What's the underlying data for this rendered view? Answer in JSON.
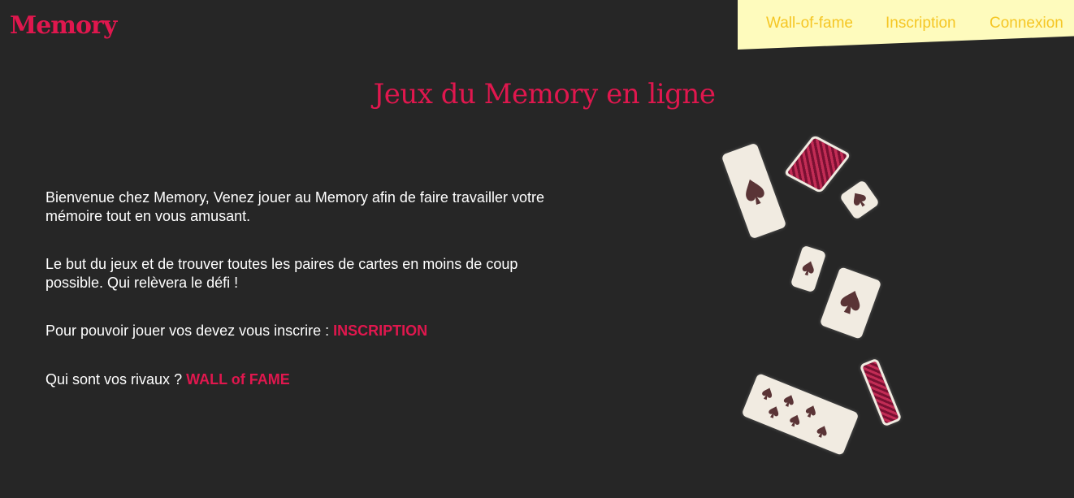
{
  "header": {
    "logo": "Memory",
    "nav": {
      "wall_of_fame": "Wall-of-fame",
      "inscription": "Inscription",
      "connexion": "Connexion"
    }
  },
  "main": {
    "title": "Jeux du Memory en ligne",
    "intro": "Bienvenue chez Memory, Venez jouer au Memory afin de faire travailler votre mémoire tout en vous amusant.",
    "goal": "Le but du jeux et de trouver toutes les paires de cartes en moins de coup possible. Qui relèvera le défi !",
    "signup_text": "Pour pouvoir jouer vos devez vous inscrire : ",
    "signup_link": "INSCRIPTION",
    "rivals_text": "Qui sont vos rivaux ? ",
    "rivals_link": "WALL of FAME"
  },
  "image": {
    "icon": "flying-playing-cards-illustration"
  },
  "colors": {
    "background": "#262626",
    "accent": "#e0174e",
    "nav_bg": "#fefbbd",
    "nav_text": "#f5c624",
    "text": "#ffffff"
  }
}
